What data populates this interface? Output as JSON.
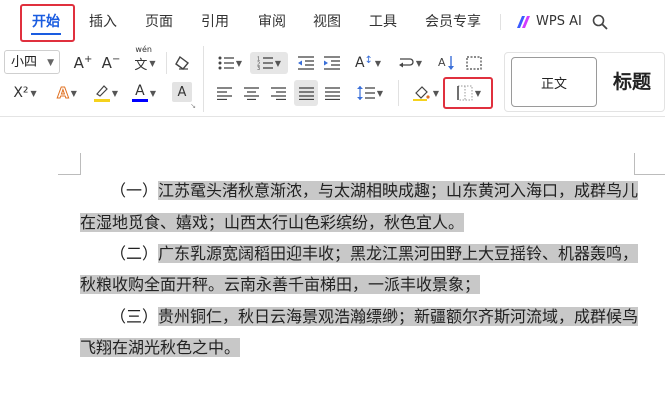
{
  "menu": {
    "tabs": [
      "开始",
      "插入",
      "页面",
      "引用",
      "审阅",
      "视图",
      "工具",
      "会员专享"
    ],
    "wps_ai": "WPS AI"
  },
  "toolbar": {
    "font_size": "小四",
    "text_grow": "A⁺",
    "text_shrink": "A⁻",
    "phonetic": "wén",
    "superscript": "X²",
    "style_normal": "正文",
    "style_heading": "标题",
    "font_color": "#0000ff",
    "highlight_color": "#f5d21d",
    "icons": [
      "clear-format-icon",
      "bullet-list-icon",
      "numbered-list-icon",
      "decrease-indent-icon",
      "increase-indent-icon",
      "change-case-icon",
      "line-break-icon",
      "sort-icon",
      "page-border-icon",
      "align-left-icon",
      "align-center-icon",
      "align-right-icon",
      "justify-icon",
      "distributed-icon",
      "line-spacing-icon",
      "shading-icon",
      "borders-icon"
    ]
  },
  "document": {
    "lines": [
      {
        "pre": "（一）",
        "text": "江苏鼋头渚秋意渐浓，与太湖相映成趣；山东黄河入海口，成群鸟儿"
      },
      {
        "pre": "",
        "text": "在湿地觅食、嬉戏；山西太行山色彩缤纷，秋色宜人。"
      },
      {
        "pre": "（二）",
        "text": "广东乳源宽阔稻田迎丰收；黑龙江黑河田野上大豆摇铃、机器轰鸣，"
      },
      {
        "pre": "",
        "text": "秋粮收购全面开秤。云南永善千亩梯田，一派丰收景象；"
      },
      {
        "pre": "（三）",
        "text": "贵州铜仁，秋日云海景观浩瀚缥缈；新疆额尔齐斯河流域，成群候鸟"
      },
      {
        "pre": "",
        "text": "飞翔在湖光秋色之中。"
      }
    ]
  }
}
